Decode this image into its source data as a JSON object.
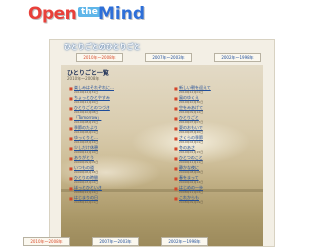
{
  "logo": {
    "word1": "Open",
    "word2": "the",
    "word3": "Mind"
  },
  "heading": "ひとりごとのひとりごと",
  "tabs": [
    {
      "label": "2010年～2008年",
      "active": true
    },
    {
      "label": "2007年～2003年",
      "active": false
    },
    {
      "label": "2002年～1998年",
      "active": false
    }
  ],
  "panel": {
    "title": "ひとりごと一覧",
    "subtitle": "2010年～2008年"
  },
  "entries_left": [
    {
      "title": "楽しみはそれぞれに…",
      "date": "2010年12月31日"
    },
    {
      "title": "ちょっとひとやすみ",
      "date": "2010年11月20日"
    },
    {
      "title": "ひとりごとのつづき",
      "date": "2010年10月08日"
    },
    {
      "title": "「Tomorrow」",
      "date": "2010年08月15日"
    },
    {
      "title": "季節のたより",
      "date": "2010年06月01日"
    },
    {
      "title": "ゆっくりと…",
      "date": "2010年03月22日"
    },
    {
      "title": "少しだけ休憩",
      "date": "2009年12月10日"
    },
    {
      "title": "ありがとう",
      "date": "2009年09月05日"
    },
    {
      "title": "いつもの道",
      "date": "2009年06月18日"
    },
    {
      "title": "ひとりの時間",
      "date": "2009年03月02日"
    },
    {
      "title": "ほっとひといき",
      "date": "2008年12月24日"
    },
    {
      "title": "はじまりの日",
      "date": "2008年10月01日"
    }
  ],
  "entries_right": [
    {
      "title": "新しい朝を迎えて",
      "date": "2010年12月01日"
    },
    {
      "title": "風のゆくえ",
      "date": "2010年10月30日"
    },
    {
      "title": "空をみあげて",
      "date": "2010年09月12日"
    },
    {
      "title": "ひとりごと",
      "date": "2010年07月07日"
    },
    {
      "title": "夏のおもいで",
      "date": "2010年05月20日"
    },
    {
      "title": "さくらの季節",
      "date": "2010年04月01日"
    },
    {
      "title": "冬のあさ",
      "date": "2010年01月15日"
    },
    {
      "title": "ひとつのこと",
      "date": "2009年11月11日"
    },
    {
      "title": "静かな夜に",
      "date": "2009年08月08日"
    },
    {
      "title": "春をまって",
      "date": "2009年02月14日"
    },
    {
      "title": "はじめの一歩",
      "date": "2008年11月03日"
    },
    {
      "title": "これからも",
      "date": "2008年09月09日"
    }
  ],
  "bottom_tabs": [
    {
      "label": "2010年～2008年"
    },
    {
      "label": "2007年～2003年"
    },
    {
      "label": "2002年～1998年"
    }
  ]
}
